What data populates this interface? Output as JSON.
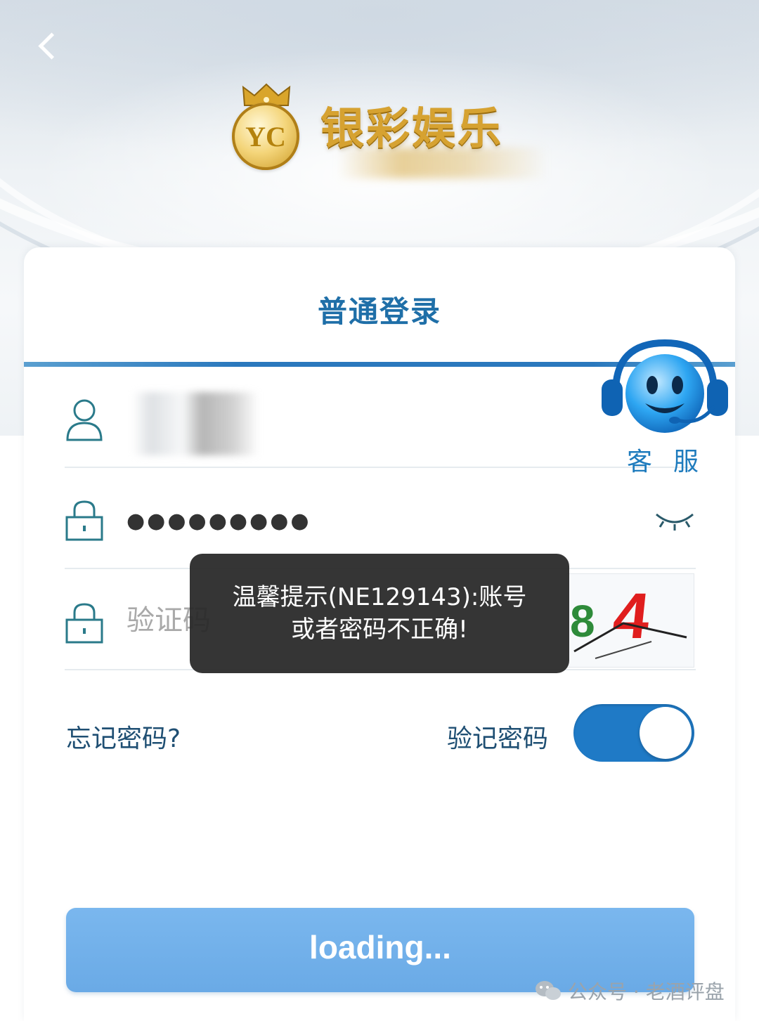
{
  "header": {
    "back_icon": "chevron-left-icon",
    "brand_title": "银彩娱乐",
    "brand_emblem_text": "YC"
  },
  "login": {
    "tab_title": "普通登录",
    "username_icon": "user-icon",
    "password_icon": "lock-icon",
    "password_mask": "●●●●●●●●●",
    "password_visibility_icon": "eye-closed-icon",
    "captcha_icon": "lock-icon",
    "captcha_placeholder": "验证码",
    "captcha_text": "84"
  },
  "service": {
    "icon": "headset-smiley-icon",
    "label": "客服"
  },
  "options": {
    "forgot_label": "忘记密码?",
    "remember_label": "验记密码",
    "remember_on": true
  },
  "submit": {
    "label": "loading..."
  },
  "toast": {
    "message": "温馨提示(NE129143):账号或者密码不正确!"
  },
  "watermark": {
    "text": "公众号 · 老酒评盘",
    "icon": "wechat-icon"
  },
  "colors": {
    "accent": "#1f7ac6",
    "button": "#6aaae6",
    "brand_gold": "#d6a231",
    "toast_bg": "#282828"
  }
}
